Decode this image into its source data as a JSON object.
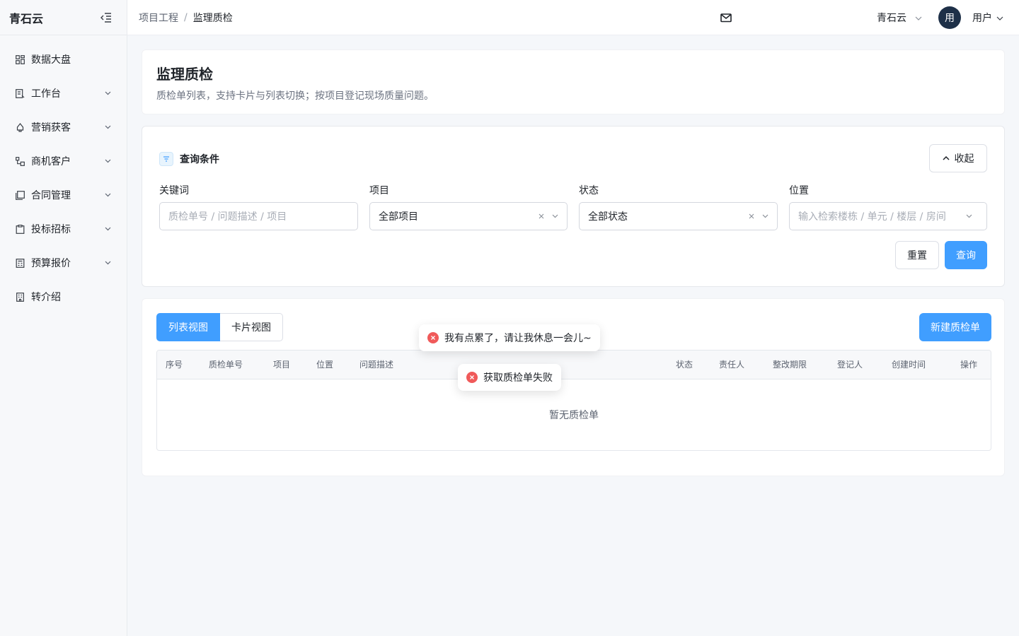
{
  "app": {
    "brand": "青石云"
  },
  "sidebar": {
    "items": [
      {
        "label": "数据大盘",
        "icon": "dashboard-icon",
        "has_children": false
      },
      {
        "label": "工作台",
        "icon": "workbench-icon",
        "has_children": true
      },
      {
        "label": "营销获客",
        "icon": "marketing-icon",
        "has_children": true
      },
      {
        "label": "商机客户",
        "icon": "customers-icon",
        "has_children": true
      },
      {
        "label": "合同管理",
        "icon": "contract-icon",
        "has_children": true
      },
      {
        "label": "投标招标",
        "icon": "bidding-icon",
        "has_children": true
      },
      {
        "label": "预算报价",
        "icon": "calculator-icon",
        "has_children": true
      },
      {
        "label": "转介绍",
        "icon": "building-icon",
        "has_children": false
      }
    ]
  },
  "header": {
    "breadcrumb": {
      "parent": "项目工程",
      "separator": "/",
      "current": "监理质检"
    },
    "org_name": "青石云",
    "avatar_text": "用",
    "user_name": "用户"
  },
  "page": {
    "title": "监理质检",
    "description": "质检单列表，支持卡片与列表切换；按项目登记现场质量问题。"
  },
  "query": {
    "title": "查询条件",
    "fold_label": "收起",
    "fields": [
      {
        "label": "关键词",
        "placeholder": "质检单号 / 问题描述 / 项目",
        "value": ""
      },
      {
        "label": "项目",
        "placeholder": "",
        "value": "全部项目"
      },
      {
        "label": "状态",
        "placeholder": "",
        "value": "全部状态"
      },
      {
        "label": "位置",
        "placeholder": "输入检索楼栋 / 单元 / 楼层 / 房间",
        "value": ""
      }
    ],
    "reset_label": "重置",
    "query_label": "查询"
  },
  "list": {
    "views": [
      "列表视图",
      "卡片视图"
    ],
    "active_view": "列表视图",
    "new_button": "新建质检单",
    "columns": [
      "序号",
      "质检单号",
      "项目",
      "位置",
      "问题描述",
      "状态",
      "责任人",
      "整改期限",
      "登记人",
      "创建时间",
      "操作"
    ],
    "rows": [],
    "empty_text": "暂无质检单"
  },
  "toasts": [
    {
      "type": "error",
      "message": "我有点累了，请让我休息一会儿~"
    },
    {
      "type": "error",
      "message": "获取质检单失败"
    }
  ],
  "colors": {
    "primary": "#409eff",
    "error": "#f05a5a",
    "avatar_bg": "#1e3048"
  }
}
